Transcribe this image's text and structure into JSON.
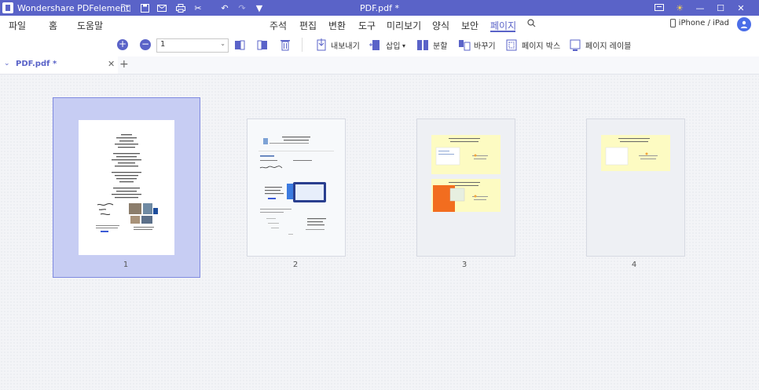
{
  "titlebar": {
    "app_name": "Wondershare PDFelement",
    "document_title": "PDF.pdf *",
    "quick_icons": [
      "open-folder-icon",
      "save-icon",
      "email-icon",
      "print-icon",
      "cut-icon",
      "undo-icon",
      "redo-icon",
      "customize-dropdown-icon"
    ],
    "window_icons": [
      "feedback-icon",
      "theme-icon",
      "minimize-icon",
      "maximize-icon",
      "close-icon"
    ]
  },
  "menubar": {
    "left": [
      "파일",
      "홈",
      "도움말"
    ],
    "center": [
      "주석",
      "편집",
      "변환",
      "도구",
      "미리보기",
      "양식",
      "보안",
      "페이지"
    ],
    "active": "페이지",
    "device": "iPhone / iPad"
  },
  "toolbar": {
    "page_value": "1",
    "actions": {
      "extract": "내보내기",
      "insert": "삽입",
      "split": "분할",
      "replace": "바꾸기",
      "page_box": "페이지 박스",
      "page_label": "페이지 레이블"
    }
  },
  "tab": {
    "name": "PDF.pdf *"
  },
  "pages": [
    {
      "number": "1",
      "selected": true
    },
    {
      "number": "2",
      "selected": false
    },
    {
      "number": "3",
      "selected": false
    },
    {
      "number": "4",
      "selected": false
    }
  ],
  "colors": {
    "accent": "#5a63c8",
    "selected_page": "#c7cdf3",
    "zoom_icon": "#5a63c8",
    "page3_block": "#f26d1f",
    "page_note": "#fdfbc2"
  }
}
